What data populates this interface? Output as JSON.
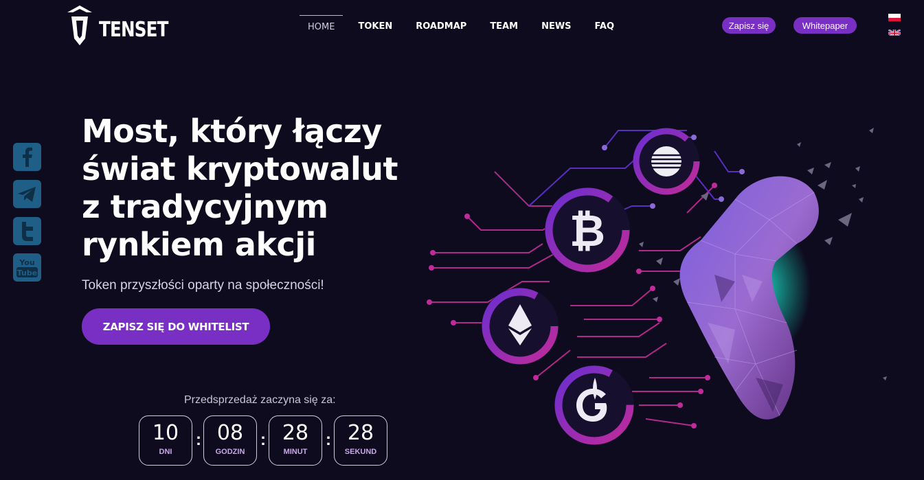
{
  "brand": {
    "name": "TENSET"
  },
  "nav": {
    "items": [
      {
        "label": "HOME",
        "active": true
      },
      {
        "label": "TOKEN"
      },
      {
        "label": "ROADMAP"
      },
      {
        "label": "TEAM"
      },
      {
        "label": "NEWS"
      },
      {
        "label": "FAQ"
      }
    ]
  },
  "header_buttons": {
    "signup": "Zapisz się",
    "whitepaper": "Whitepaper"
  },
  "languages": [
    "pl-flag-icon",
    "uk-flag-icon"
  ],
  "social": [
    "facebook-icon",
    "telegram-icon",
    "twitter-icon",
    "youtube-icon"
  ],
  "hero": {
    "headline_lines": [
      "Most, który łączy",
      "świat kryptowalut",
      "z tradycyjnym",
      "rynkiem akcji"
    ],
    "subtitle": "Token przyszłości oparty na społeczności!",
    "cta": "ZAPISZ SIĘ DO WHITELIST"
  },
  "countdown": {
    "label": "Przedsprzedaż zaczyna się za:",
    "units": [
      {
        "value": "10",
        "label": "DNI"
      },
      {
        "value": "08",
        "label": "GODZIN"
      },
      {
        "value": "28",
        "label": "MINUT"
      },
      {
        "value": "28",
        "label": "SEKUND"
      }
    ],
    "separator": ":"
  },
  "illustration": {
    "icons": [
      "att-icon",
      "bitcoin-icon",
      "ethereum-icon",
      "gazprom-icon"
    ]
  },
  "colors": {
    "background": "#0e0b1e",
    "accent": "#7a2fc4",
    "magenta": "#c02a9a"
  }
}
